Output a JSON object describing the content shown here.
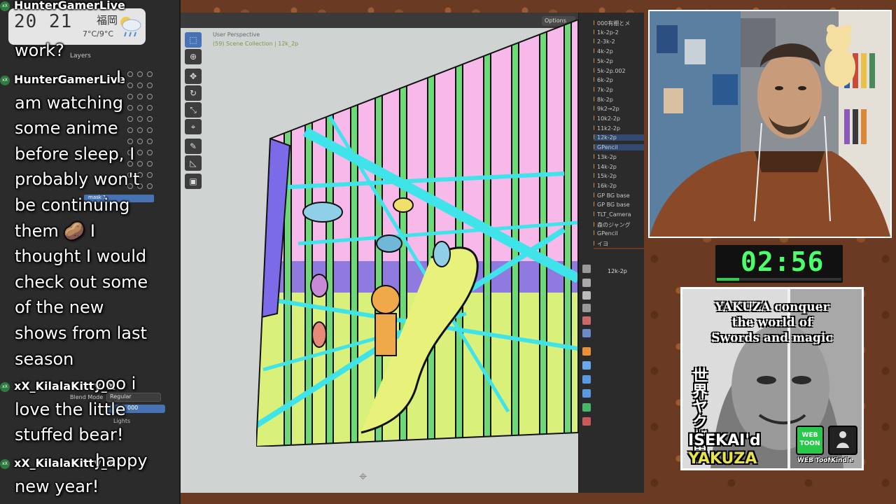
{
  "weather": {
    "time_hours": "20",
    "time_minutes": "21",
    "city": "福岡",
    "temperature": "7°C/9°C",
    "icon": "rain-cloud-icon"
  },
  "chat": {
    "messages": [
      {
        "username": "HunterGamerLive",
        "lines": [
          "work?"
        ]
      },
      {
        "username": "HunterGamerLive",
        "lines": [
          "I",
          "am watching",
          "some anime",
          "before sleep, I",
          "probably won't",
          "be continuing",
          "them 🥔 I",
          "thought I would",
          "check out some",
          "of the new",
          "shows from last",
          "season"
        ]
      },
      {
        "username": "xX_KilalaKitty_X",
        "lines": [
          "ooo i",
          "love the little",
          "stuffed bear!"
        ]
      },
      {
        "username": "xX_KilalaKitty_X",
        "lines": [
          "happy",
          "new year!"
        ]
      }
    ]
  },
  "blender": {
    "layers_label": "Layers",
    "mask_label": "mask 1",
    "blend_mode_label": "Blend Mode",
    "blend_mode_value": "Regular",
    "opacity_value": "000",
    "lights_label": "Lights",
    "viewport_label": "User Perspective",
    "viewport_collection": "(59) Scene Collection | 12k_2p",
    "options_label": "Options",
    "properties_object": "12k-2p",
    "outliner_items": [
      {
        "label": "000有棚とメ",
        "selected": false
      },
      {
        "label": "1k-2p-2",
        "selected": false
      },
      {
        "label": "2-3k-2",
        "selected": false
      },
      {
        "label": "4k-2p",
        "selected": false
      },
      {
        "label": "5k-2p",
        "selected": false
      },
      {
        "label": "5k-2p.002",
        "selected": false
      },
      {
        "label": "6k-2p",
        "selected": false
      },
      {
        "label": "7k-2p",
        "selected": false
      },
      {
        "label": "8k-2p",
        "selected": false
      },
      {
        "label": "9k2→2p",
        "selected": false
      },
      {
        "label": "10k2-2p",
        "selected": false
      },
      {
        "label": "11k2-2p",
        "selected": false
      },
      {
        "label": "12k-2p",
        "selected": true
      },
      {
        "label": "GPencil",
        "selected": true
      },
      {
        "label": "13k-2p",
        "selected": false
      },
      {
        "label": "14k-2p",
        "selected": false
      },
      {
        "label": "15k-2p",
        "selected": false
      },
      {
        "label": "16k-2p",
        "selected": false
      },
      {
        "label": "GP BG base",
        "selected": false
      },
      {
        "label": "GP BG base",
        "selected": false
      },
      {
        "label": "TLT_Camera",
        "selected": false
      },
      {
        "label": "森のジャング",
        "selected": false
      },
      {
        "label": "GPencil",
        "selected": false
      },
      {
        "label": "イヨ",
        "selected": false
      }
    ]
  },
  "timer": {
    "display": "02:56",
    "progress": 0.18
  },
  "book": {
    "title_lines": [
      "YAKUZA conquer",
      "the world of",
      "Swords and magic"
    ],
    "japanese_title": "世界ヤクザ異",
    "subtitle": "ISEKAI'd",
    "subtitle_word": "YAKUZA",
    "webtoon_badge": "WEB TOON",
    "webtoon_label": "WEB TooN",
    "kindle_label": "Kindle"
  }
}
